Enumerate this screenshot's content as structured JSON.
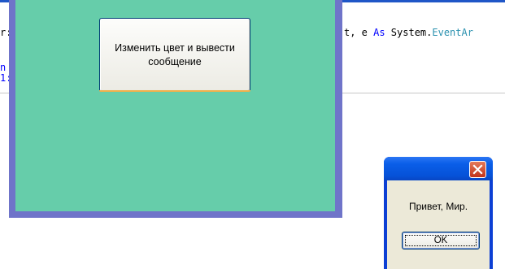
{
  "editor": {
    "line1_left": "r:",
    "line1_right_plain": "t, e ",
    "line1_right_kw": "As",
    "line1_right_ns": " System.",
    "line1_right_type": "EventAr",
    "line2_left": "n",
    "line3_left": "1:",
    "colors": {
      "keyword": "#0000ff",
      "type": "#2b91af",
      "separator": "#c8c8c8"
    }
  },
  "form": {
    "client_color": "#66cdaa",
    "border_color": "#6f74c9",
    "button_label": "Изменить цвет и вывести сообщение"
  },
  "message_box": {
    "message": "Привет, Мир.",
    "ok_label": "OK",
    "close_icon": "close-icon",
    "title_color": "#0a5ee8"
  }
}
